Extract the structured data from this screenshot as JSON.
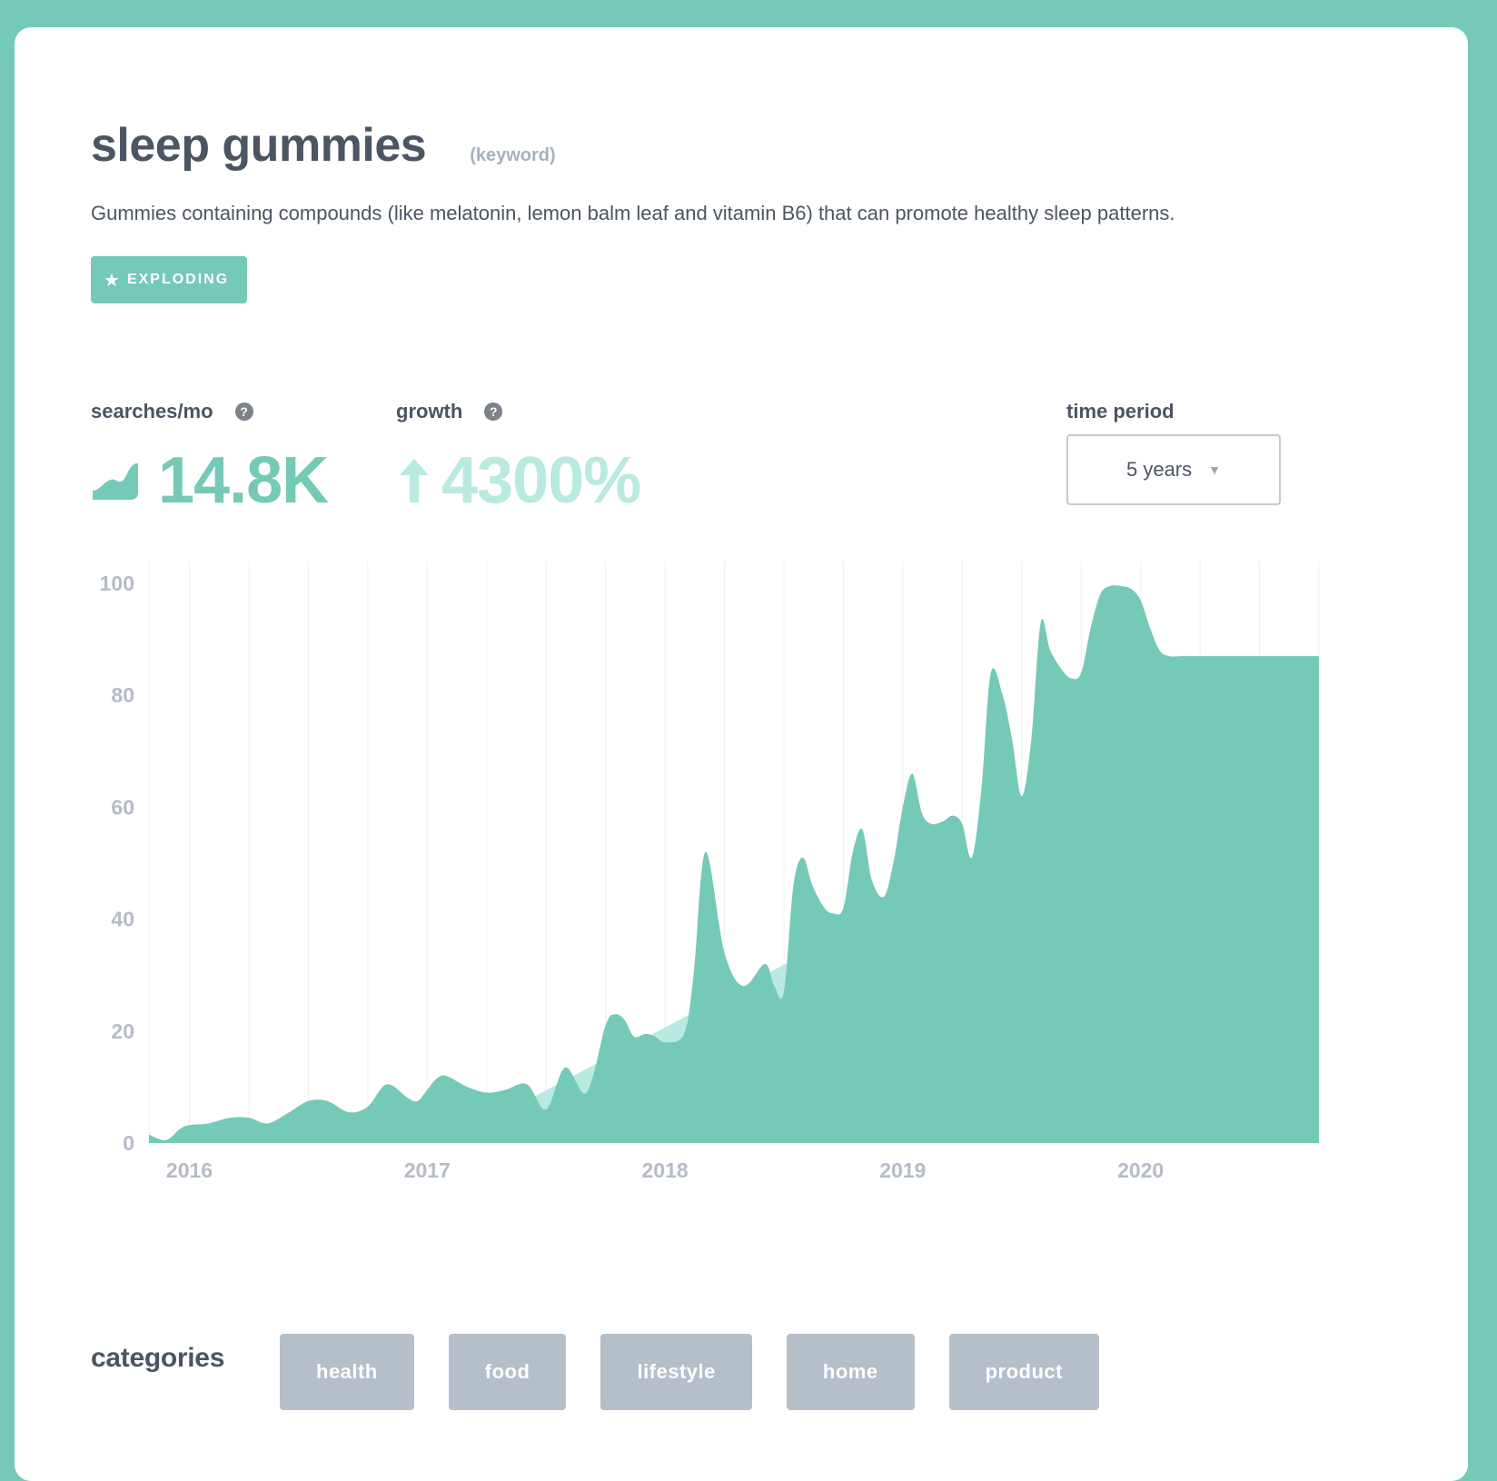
{
  "header": {
    "title": "sleep gummies",
    "kind": "(keyword)",
    "description": "Gummies containing compounds (like melatonin, lemon balm leaf and vitamin B6) that can promote healthy sleep patterns.",
    "badge": "EXPLODING"
  },
  "stats": {
    "searches_label": "searches/mo",
    "searches_value": "14.8K",
    "growth_label": "growth",
    "growth_value": "4300%",
    "help_glyph": "?"
  },
  "time_period": {
    "label": "time period",
    "selected": "5 years"
  },
  "categories": {
    "label": "categories",
    "items": [
      "health",
      "food",
      "lifestyle",
      "home",
      "product"
    ]
  },
  "colors": {
    "brand": "#75c9b7",
    "trend_fill": "#b8eadf",
    "tag_bg": "#b5bfca",
    "text": "#4b5563",
    "axis_text": "#b5bcc7"
  },
  "chart_data": {
    "type": "area",
    "ylim": [
      0,
      100
    ],
    "yticks": [
      0,
      20,
      40,
      60,
      80,
      100
    ],
    "xticks": [
      {
        "label": "2016",
        "x": 2016.0
      },
      {
        "label": "2017",
        "x": 2017.0
      },
      {
        "label": "2018",
        "x": 2018.0
      },
      {
        "label": "2019",
        "x": 2019.0
      },
      {
        "label": "2020",
        "x": 2020.0
      }
    ],
    "xlim": [
      2015.83,
      2020.75
    ],
    "grid": "vertical",
    "trend": {
      "x": [
        2017.08,
        2020.2
      ],
      "y": [
        0,
        70
      ]
    },
    "series": [
      {
        "x": [
          2015.83,
          2015.9,
          2015.96,
          2016.0,
          2016.08,
          2016.17,
          2016.25,
          2016.33,
          2016.42,
          2016.5,
          2016.58,
          2016.67,
          2016.75,
          2016.83,
          2016.92,
          2016.96,
          2017.0,
          2017.04,
          2017.08,
          2017.17,
          2017.25,
          2017.33,
          2017.42,
          2017.5,
          2017.58,
          2017.67,
          2017.75,
          2017.79,
          2017.83,
          2017.87,
          2017.92,
          2017.96,
          2018.0,
          2018.08,
          2018.12,
          2018.17,
          2018.25,
          2018.33,
          2018.42,
          2018.46,
          2018.5,
          2018.54,
          2018.58,
          2018.62,
          2018.67,
          2018.71,
          2018.75,
          2018.79,
          2018.83,
          2018.87,
          2018.92,
          2018.96,
          2019.0,
          2019.04,
          2019.08,
          2019.12,
          2019.17,
          2019.21,
          2019.25,
          2019.29,
          2019.33,
          2019.37,
          2019.42,
          2019.46,
          2019.5,
          2019.54,
          2019.58,
          2019.62,
          2019.67,
          2019.71,
          2019.75,
          2019.79,
          2019.83,
          2019.87,
          2019.92,
          2019.96,
          2020.0,
          2020.04,
          2020.08,
          2020.12,
          2020.17,
          2020.21,
          2020.25,
          2020.29,
          2020.33,
          2020.37,
          2020.42,
          2020.46,
          2020.5,
          2020.54,
          2020.58,
          2020.62,
          2020.67,
          2020.71,
          2020.75
        ],
        "y": [
          1.5,
          0.5,
          2.5,
          3.2,
          3.5,
          4.5,
          4.5,
          3.5,
          5.5,
          7.5,
          7.5,
          5.5,
          6.5,
          10.5,
          8.0,
          7.5,
          9.5,
          11.5,
          12.0,
          10.0,
          9.0,
          9.5,
          10.5,
          6.0,
          13.5,
          9.0,
          21.0,
          23.0,
          22.0,
          19.0,
          19.5,
          19.0,
          18.0,
          19.5,
          30.0,
          52.0,
          34.0,
          28.0,
          32.0,
          28.0,
          27.0,
          46.0,
          51.0,
          46.0,
          42.0,
          41.0,
          42.0,
          52.0,
          56.0,
          47.0,
          44.0,
          50.0,
          60.0,
          66.0,
          59.0,
          57.0,
          57.5,
          58.5,
          57.0,
          51.0,
          63.0,
          84.0,
          80.0,
          72.0,
          62.0,
          72.0,
          93.0,
          88.0,
          84.5,
          83.0,
          84.0,
          92.0,
          98.0,
          99.5,
          99.5,
          99.0,
          97.0,
          92.0,
          88.0,
          87.0,
          87.0,
          87.0,
          87.0,
          87.0,
          87.0,
          87.0,
          87.0,
          87.0,
          87.0,
          87.0,
          87.0,
          87.0,
          87.0,
          87.0,
          87.0
        ]
      }
    ]
  }
}
